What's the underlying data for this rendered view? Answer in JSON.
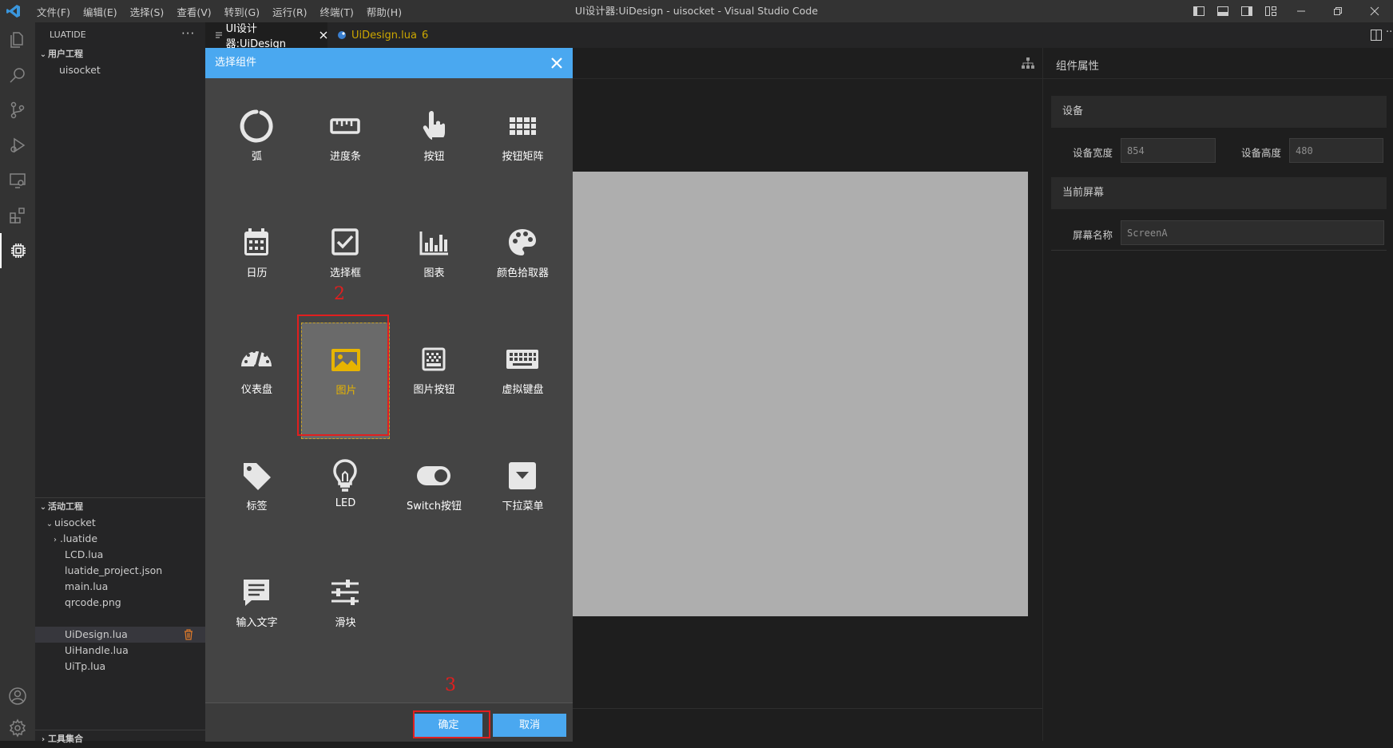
{
  "window": {
    "title": "UI设计器:UiDesign - uisocket - Visual Studio Code",
    "menu": [
      "文件(F)",
      "编辑(E)",
      "选择(S)",
      "查看(V)",
      "转到(G)",
      "运行(R)",
      "终端(T)",
      "帮助(H)"
    ]
  },
  "sidebar": {
    "header": "LUATIDE",
    "user_project_section": "用户工程",
    "user_projects": [
      "uisocket"
    ],
    "active_project_section": "活动工程",
    "active_project": "uisocket",
    "files": [
      ".luatide",
      "LCD.lua",
      "luatide_project.json",
      "main.lua",
      "qrcode.png",
      "UiDesign.lua",
      "UiHandle.lua",
      "UiTp.lua"
    ],
    "selected_file": "UiDesign.lua",
    "bottom_section": "工具集合"
  },
  "tabs": [
    {
      "label": "UI设计器:UiDesign",
      "active": true
    },
    {
      "label": "UiDesign.lua",
      "badge": "6",
      "color": "#cca700"
    }
  ],
  "properties": {
    "title": "组件属性",
    "device_section": "设备",
    "device_width_label": "设备宽度",
    "device_width": "854",
    "device_height_label": "设备高度",
    "device_height": "480",
    "screen_section": "当前屏幕",
    "screen_name_label": "屏幕名称",
    "screen_name": "ScreenA"
  },
  "dialog": {
    "title": "选择组件",
    "components": [
      {
        "label": "弧",
        "icon": "arc-icon"
      },
      {
        "label": "进度条",
        "icon": "progress-bar-icon"
      },
      {
        "label": "按钮",
        "icon": "pointer-hand-icon"
      },
      {
        "label": "按钮矩阵",
        "icon": "button-matrix-icon"
      },
      {
        "label": "日历",
        "icon": "calendar-icon"
      },
      {
        "label": "选择框",
        "icon": "checkbox-icon"
      },
      {
        "label": "图表",
        "icon": "chart-icon"
      },
      {
        "label": "颜色拾取器",
        "icon": "palette-icon"
      },
      {
        "label": "仪表盘",
        "icon": "gauge-icon"
      },
      {
        "label": "图片",
        "icon": "image-icon",
        "selected": true
      },
      {
        "label": "图片按钮",
        "icon": "image-button-icon"
      },
      {
        "label": "虚拟键盘",
        "icon": "keyboard-icon"
      },
      {
        "label": "标签",
        "icon": "tag-icon"
      },
      {
        "label": "LED",
        "icon": "bulb-icon"
      },
      {
        "label": "Switch按钮",
        "icon": "switch-icon"
      },
      {
        "label": "下拉菜单",
        "icon": "dropdown-icon"
      },
      {
        "label": "输入文字",
        "icon": "textarea-icon"
      },
      {
        "label": "滑块",
        "icon": "slider-icon"
      }
    ],
    "confirm_label": "确定",
    "cancel_label": "取消"
  },
  "annotations": {
    "step2": "2",
    "step3": "3",
    "color": "#e11f1f"
  },
  "colors": {
    "accent": "#4aa8f0",
    "selected_text": "#e7b400"
  }
}
